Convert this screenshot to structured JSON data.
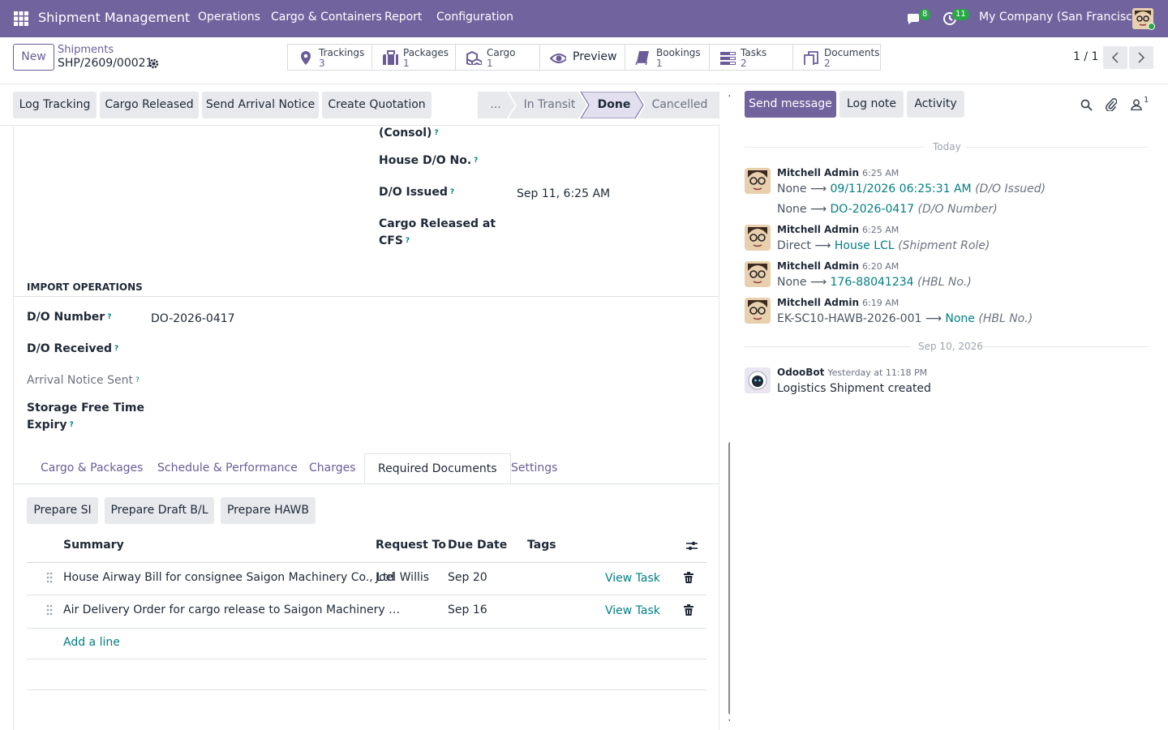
{
  "topbar": {
    "app_name": "Shipment Management",
    "menu": [
      "Operations",
      "Cargo & Containers",
      "Report",
      "Configuration"
    ],
    "messages_count": "8",
    "activities_count": "11",
    "company": "My Company (San Francisco)",
    "bg_color": "#71639e"
  },
  "control_panel": {
    "new_label": "New",
    "breadcrumb_parent": "Shipments",
    "record_name": "SHP/2609/00021",
    "smart_buttons": [
      {
        "label": "Trackings",
        "count": "3",
        "icon": "map-pin-icon"
      },
      {
        "label": "Packages",
        "count": "1",
        "icon": "suitcase-icon"
      },
      {
        "label": "Cargo",
        "count": "1",
        "icon": "cubes-icon"
      },
      {
        "label": "Preview",
        "count": "",
        "icon": "eye-icon"
      },
      {
        "label": "Bookings",
        "count": "1",
        "icon": "book-icon"
      },
      {
        "label": "Tasks",
        "count": "2",
        "icon": "tasks-icon"
      },
      {
        "label": "Documents",
        "count": "2",
        "icon": "documents-icon"
      }
    ],
    "pager": "1 / 1"
  },
  "statusbar": {
    "buttons": [
      "Log Tracking",
      "Cargo Released",
      "Send Arrival Notice",
      "Create Quotation"
    ],
    "stages": [
      "...",
      "In Transit",
      "Done",
      "Cancelled"
    ],
    "active_stage": "Done"
  },
  "form": {
    "consol_label": "(Consol)",
    "house_do_label": "House D/O No.",
    "do_issued_label": "D/O Issued",
    "do_issued_value": "Sep 11, 6:25 AM",
    "cargo_released_label_1": "Cargo Released at",
    "cargo_released_label_2": "CFS",
    "section_title": "IMPORT OPERATIONS",
    "do_number_label": "D/O Number",
    "do_number_value": "DO-2026-0417",
    "do_received_label": "D/O Received",
    "arrival_notice_label": "Arrival Notice Sent",
    "storage_label_1": "Storage Free Time",
    "storage_label_2": "Expiry",
    "help_mark": "?"
  },
  "tabs": [
    "Cargo & Packages",
    "Schedule & Performance",
    "Charges",
    "Required Documents",
    "Settings"
  ],
  "active_tab": "Required Documents",
  "documents": {
    "buttons": [
      "Prepare SI",
      "Prepare Draft B/L",
      "Prepare HAWB"
    ],
    "columns": [
      "Summary",
      "Request To",
      "Due Date",
      "Tags"
    ],
    "rows": [
      {
        "summary": "House Airway Bill for consignee Saigon Machinery Co., Ltd",
        "request_to": "Joel Willis",
        "due": "Sep 20",
        "action": "View Task"
      },
      {
        "summary": "Air Delivery Order for cargo release to Saigon Machinery …",
        "request_to": "",
        "due": "Sep 16",
        "action": "View Task"
      }
    ],
    "add_line": "Add a line"
  },
  "chatter": {
    "send_message": "Send message",
    "log_note": "Log note",
    "activity": "Activity",
    "followers_count": "1",
    "today_label": "Today",
    "older_label": "Sep 10, 2026",
    "messages": [
      {
        "author": "Mitchell Admin",
        "time": "6:25 AM",
        "changes": [
          {
            "old": "None",
            "new": "09/11/2026 06:25:31 AM",
            "field": "(D/O Issued)"
          },
          {
            "old": "None",
            "new": "DO-2026-0417",
            "field": "(D/O Number)"
          }
        ]
      },
      {
        "author": "Mitchell Admin",
        "time": "6:25 AM",
        "changes": [
          {
            "old": "Direct",
            "new": "House LCL",
            "field": "(Shipment Role)"
          }
        ]
      },
      {
        "author": "Mitchell Admin",
        "time": "6:20 AM",
        "changes": [
          {
            "old": "None",
            "new": "176-88041234",
            "field": "(HBL No.)"
          }
        ]
      },
      {
        "author": "Mitchell Admin",
        "time": "6:19 AM",
        "changes": [
          {
            "old": "EK-SC10-HAWB-2026-001",
            "new": "None",
            "field": "(HBL No.)"
          }
        ]
      }
    ],
    "bot": {
      "author": "OdooBot",
      "time": "Yesterday at 11:18 PM",
      "body": "Logistics Shipment created"
    }
  }
}
